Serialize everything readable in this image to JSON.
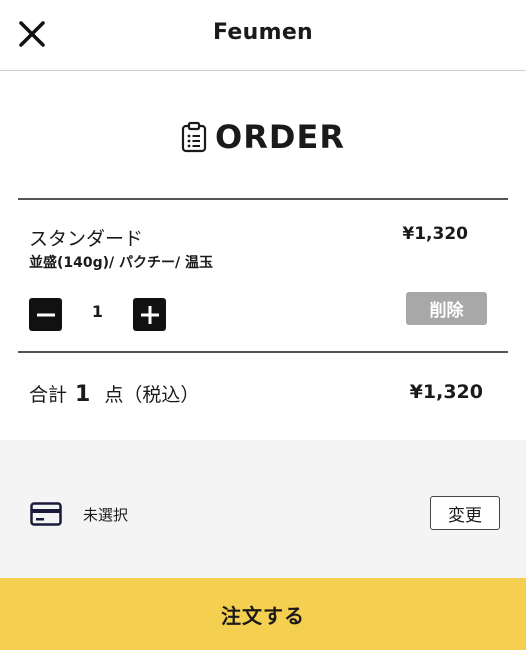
{
  "header": {
    "title": "Feumen",
    "close_icon": "close-icon"
  },
  "order": {
    "title": "ORDER",
    "title_icon": "clipboard-list-icon"
  },
  "item": {
    "name": "スタンダード",
    "options": "並盛(140g)/ パクチー/ 温玉",
    "price": "¥1,320",
    "quantity": "1",
    "minus_icon": "minus-icon",
    "plus_icon": "plus-icon",
    "delete_label": "削除"
  },
  "total": {
    "prefix": "合計",
    "count": "1",
    "suffix": "点（税込）",
    "price": "¥1,320"
  },
  "payment": {
    "icon": "credit-card-icon",
    "status": "未選択",
    "change_label": "変更"
  },
  "submit": {
    "label": "注文する"
  },
  "colors": {
    "accent": "#f5cf4f",
    "dark": "#111111",
    "disabled": "#a8a8a8",
    "panel": "#f4f4f4"
  }
}
